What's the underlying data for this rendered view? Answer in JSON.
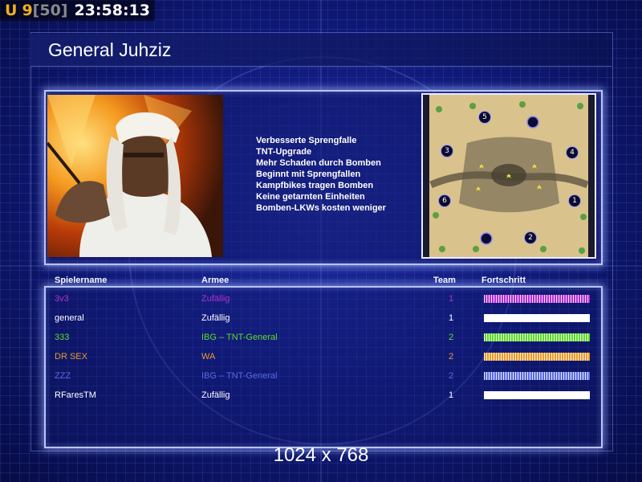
{
  "hud": {
    "status_letter": "U",
    "unit_count": "9",
    "unit_cap": "[50]",
    "clock": "23:58:13"
  },
  "title": "General Juhziz",
  "features": [
    "Verbesserte Sprengfalle",
    "TNT-Upgrade",
    "Mehr Schaden durch Bomben",
    "Beginnt mit Sprengfallen",
    "Kampfbikes tragen Bomben",
    "Keine getarnten Einheiten",
    "Bomben-LKWs kosten weniger"
  ],
  "columns": {
    "name": "Spielername",
    "army": "Armee",
    "team": "Team",
    "progress": "Fortschritt"
  },
  "players": [
    {
      "name": "3v3",
      "army": "Zufällig",
      "team": "1",
      "color": "#b030d0",
      "progress": 1.0
    },
    {
      "name": "general",
      "army": "Zufällig",
      "team": "1",
      "color": "#ffffff",
      "progress": 1.0
    },
    {
      "name": "333",
      "army": "IBG – TNT-General",
      "team": "2",
      "color": "#5ed92a",
      "progress": 1.0
    },
    {
      "name": "DR SEX",
      "army": "WA",
      "team": "2",
      "color": "#e89a2a",
      "progress": 1.0
    },
    {
      "name": "ZZZ",
      "army": "IBG – TNT-General",
      "team": "2",
      "color": "#5a6ae0",
      "progress": 1.0
    },
    {
      "name": "RFaresTM",
      "army": "Zufällig",
      "team": "1",
      "color": "#ffffff",
      "progress": 1.0
    }
  ],
  "minimap": {
    "start_positions": [
      "1",
      "2",
      "3",
      "4",
      "5",
      "6"
    ]
  },
  "resolution": "1024 x 768"
}
